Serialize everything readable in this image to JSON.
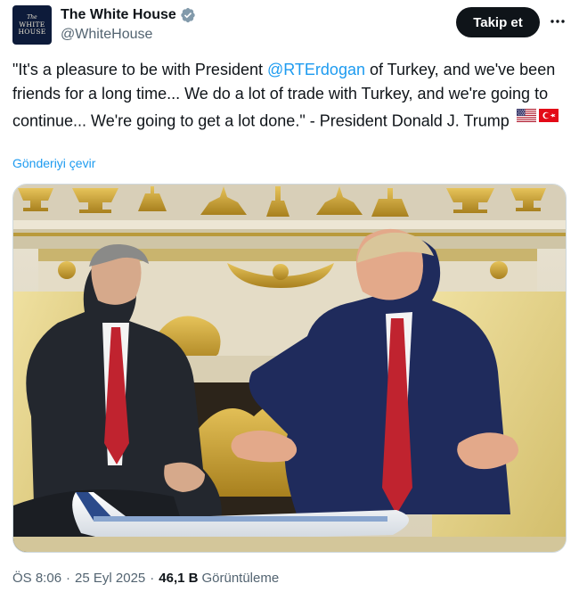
{
  "author": {
    "display_name": "The White House",
    "handle": "@WhiteHouse",
    "avatar_text": {
      "line1": "The",
      "line2": "WHITE",
      "line3": "HOUSE"
    },
    "verified": true,
    "verified_color": "#829aab"
  },
  "actions": {
    "follow_label": "Takip et",
    "more_icon": "more-horizontal-icon"
  },
  "tweet": {
    "text_part1": "\"It's a pleasure to be with President ",
    "mention": "@RTErdogan",
    "text_part2": " of Turkey, and we've been friends for a long time... We do a lot of trade with Turkey, and we're going to continue... We're going to get a lot done.\" - President Donald J. Trump",
    "flags": [
      "us-flag-icon",
      "turkey-flag-icon"
    ],
    "translate_label": "Gönderiyi çevir"
  },
  "media": {
    "kind": "photo",
    "icon": "photo-oval-office-meeting"
  },
  "meta": {
    "time": "ÖS 8:06",
    "separator": "·",
    "date": "25 Eyl 2025",
    "views_count": "46,1 B",
    "views_label": "Görüntüleme"
  },
  "colors": {
    "accent": "#1d9bf0",
    "text": "#0f1419",
    "secondary": "#536471",
    "follow_bg": "#0f1419"
  }
}
